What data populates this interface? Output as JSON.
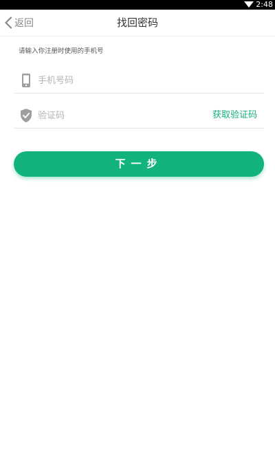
{
  "status_bar": {
    "time": "2:48",
    "wifi_icon": "wifi-icon"
  },
  "navbar": {
    "back_label": "返回",
    "back_icon": "chevron-left-icon",
    "title": "找回密码"
  },
  "form": {
    "hint": "请输入你注册时使用的手机号",
    "phone": {
      "icon": "phone-icon",
      "placeholder": "手机号码",
      "value": ""
    },
    "code": {
      "icon": "shield-check-icon",
      "placeholder": "验证码",
      "value": "",
      "get_code_label": "获取验证码"
    },
    "next_label": "下一步"
  },
  "colors": {
    "accent": "#13b37e",
    "link": "#13b07d",
    "icon_gray": "#9e9e9e"
  }
}
